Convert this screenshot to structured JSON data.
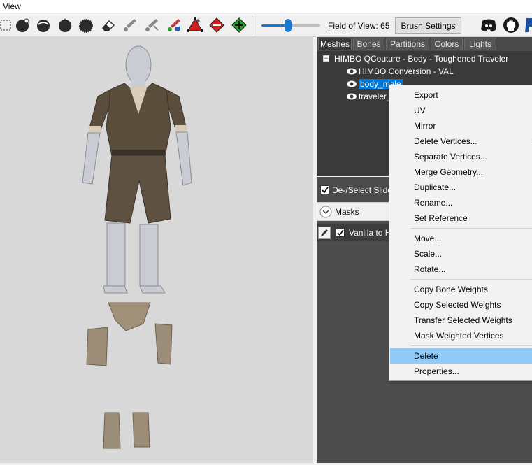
{
  "menubar": {
    "view_label": "View"
  },
  "toolbar": {
    "fov_label": "Field of View: 65",
    "fov_value": 65,
    "brush_settings_label": "Brush Settings",
    "icons": [
      "select-icon",
      "brush-icon",
      "smooth-icon",
      "move-brush-icon",
      "inflate-icon",
      "eraser-icon",
      "weight-paint-icon",
      "color-paint-icon",
      "alpha-paint-icon",
      "vertex-icon",
      "edge-icon",
      "transform-icon",
      "discord-icon",
      "github-icon",
      "paypal-icon"
    ]
  },
  "tabs": [
    "Meshes",
    "Bones",
    "Partitions",
    "Colors",
    "Lights"
  ],
  "tree": {
    "root_label": "HIMBO QCouture - Body - Toughened Traveler",
    "items": [
      {
        "label": "HIMBO Conversion - VAL"
      },
      {
        "label": "body_male"
      },
      {
        "label": "traveler_"
      }
    ]
  },
  "sliders": {
    "deselect_label": "De-/Select Slide",
    "masks_label": "Masks",
    "slider_label": "Vanilla to H"
  },
  "context_menu": {
    "group1": [
      "Export",
      "UV",
      "Mirror",
      "Delete Vertices...",
      "Separate Vertices...",
      "Merge Geometry...",
      "Duplicate...",
      "Rename...",
      "Set Reference"
    ],
    "group2": [
      "Move...",
      "Scale...",
      "Rotate..."
    ],
    "group3": [
      "Copy Bone Weights",
      "Copy Selected Weights",
      "Transfer Selected Weights",
      "Mask Weighted Vertices"
    ],
    "group4": [
      "Delete",
      "Properties..."
    ],
    "delete_vertices_shortcut": "S"
  },
  "colors": {
    "accent": "#0078d7",
    "menu_highlight": "#91c9f7",
    "viewport_bg": "#d8d8d8",
    "tree_bg": "#3a3a3a"
  }
}
